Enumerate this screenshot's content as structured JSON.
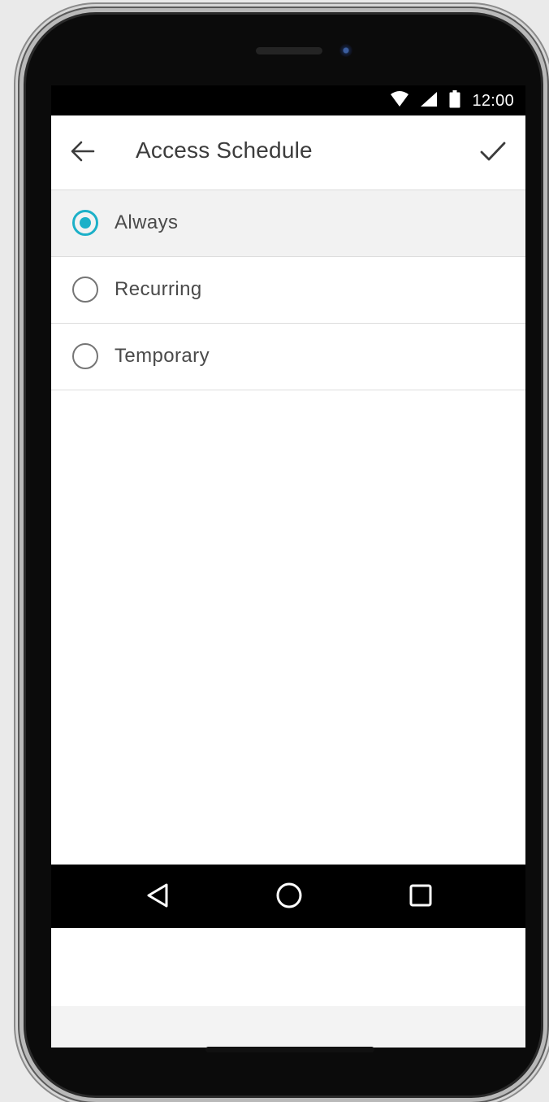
{
  "status_bar": {
    "time": "12:00",
    "icons": [
      "wifi-icon",
      "cellular-signal-icon",
      "battery-icon"
    ]
  },
  "app_bar": {
    "title": "Access Schedule",
    "back_icon": "arrow-left-icon",
    "confirm_icon": "checkmark-icon"
  },
  "options": [
    {
      "label": "Always",
      "selected": true
    },
    {
      "label": "Recurring",
      "selected": false
    },
    {
      "label": "Temporary",
      "selected": false
    }
  ],
  "nav_bar": {
    "buttons": [
      "back-triangle-icon",
      "home-circle-icon",
      "recents-square-icon"
    ]
  },
  "colors": {
    "accent": "#1cb0c8",
    "selected_row_background": "#f2f2f2",
    "status_bar_background": "#000000",
    "title_text": "#3c3c3c"
  }
}
